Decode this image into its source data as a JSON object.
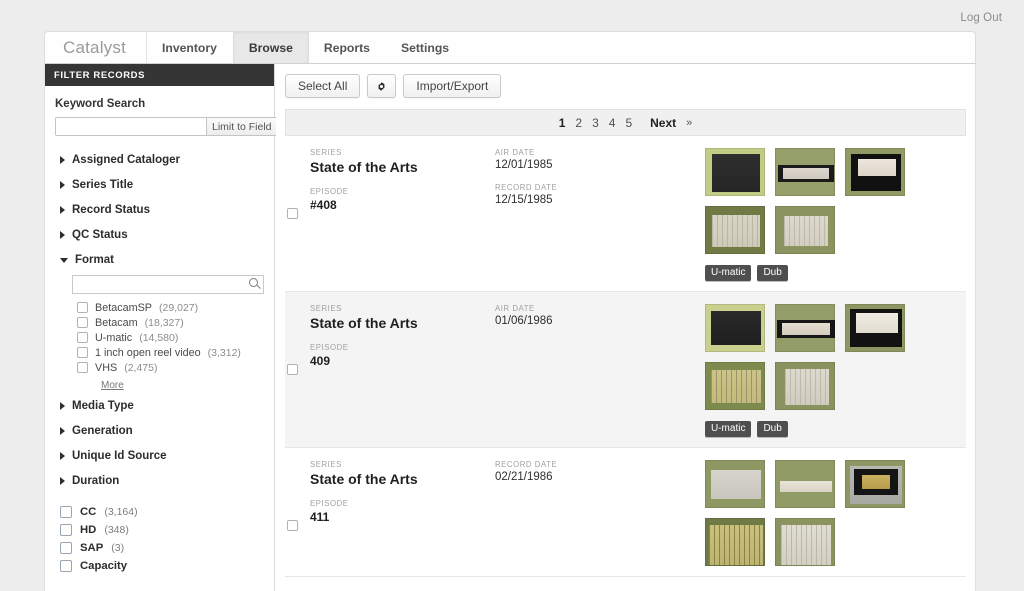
{
  "topbar": {
    "logout_label": "Log Out"
  },
  "nav": {
    "brand": "Catalyst",
    "tabs": [
      {
        "label": "Inventory",
        "active": false
      },
      {
        "label": "Browse",
        "active": true
      },
      {
        "label": "Reports",
        "active": false
      },
      {
        "label": "Settings",
        "active": false
      }
    ]
  },
  "sidebar": {
    "panel_title": "FILTER RECORDS",
    "keyword": {
      "label": "Keyword Search",
      "value": "",
      "placeholder": "",
      "limit_button": "Limit to Field"
    },
    "facets": [
      {
        "name": "Assigned Cataloger",
        "expanded": false
      },
      {
        "name": "Series Title",
        "expanded": false
      },
      {
        "name": "Record Status",
        "expanded": false
      },
      {
        "name": "QC Status",
        "expanded": false
      },
      {
        "name": "Format",
        "expanded": true
      },
      {
        "name": "Media Type",
        "expanded": false
      },
      {
        "name": "Generation",
        "expanded": false
      },
      {
        "name": "Unique Id Source",
        "expanded": false
      },
      {
        "name": "Duration",
        "expanded": false
      }
    ],
    "format": {
      "search_value": "",
      "search_placeholder": "",
      "options": [
        {
          "name": "BetacamSP",
          "count": "(29,027)",
          "checked": false
        },
        {
          "name": "Betacam",
          "count": "(18,327)",
          "checked": false
        },
        {
          "name": "U-matic",
          "count": "(14,580)",
          "checked": false
        },
        {
          "name": "1 inch open reel video",
          "count": "(3,312)",
          "checked": false
        },
        {
          "name": "VHS",
          "count": "(2,475)",
          "checked": false
        }
      ],
      "more_label": "More"
    },
    "flags": [
      {
        "name": "CC",
        "count": "(3,164)",
        "checked": false
      },
      {
        "name": "HD",
        "count": "(348)",
        "checked": false
      },
      {
        "name": "SAP",
        "count": "(3)",
        "checked": false
      },
      {
        "name": "Capacity",
        "count": "",
        "checked": false
      }
    ]
  },
  "main": {
    "toolbar": {
      "select_all": "Select All",
      "settings_icon": "gear-icon",
      "import_export": "Import/Export"
    },
    "pagination": {
      "pages": [
        "1",
        "2",
        "3",
        "4",
        "5"
      ],
      "current": "1",
      "next_label": "Next",
      "next_chevron": "»"
    },
    "labels": {
      "series": "SERIES",
      "episode": "EPISODE",
      "air_date": "AIR DATE",
      "record_date": "RECORD DATE"
    },
    "records": [
      {
        "series": "State of the Arts",
        "episode": "#408",
        "date_fields": [
          {
            "label": "AIR DATE",
            "value": "12/01/1985"
          },
          {
            "label": "RECORD DATE",
            "value": "12/15/1985"
          }
        ],
        "thumb_count": 5,
        "tags": [
          "U-matic",
          "Dub"
        ],
        "checked": false
      },
      {
        "series": "State of the Arts",
        "episode": "409",
        "date_fields": [
          {
            "label": "AIR DATE",
            "value": "01/06/1986"
          }
        ],
        "thumb_count": 5,
        "tags": [
          "U-matic",
          "Dub"
        ],
        "checked": false
      },
      {
        "series": "State of the Arts",
        "episode": "411",
        "date_fields": [
          {
            "label": "RECORD DATE",
            "value": "02/21/1986"
          }
        ],
        "thumb_count": 5,
        "tags": [],
        "checked": false
      }
    ]
  },
  "colors": {
    "page_bg": "#ededed",
    "panel_bg": "#ffffff",
    "filter_header_bg": "#353535",
    "tag_bg": "#4f4f4f",
    "pager_bg": "#f0f0f0",
    "thumb_bg": "#8d9466",
    "alt_row_bg": "#f4f4f4"
  }
}
